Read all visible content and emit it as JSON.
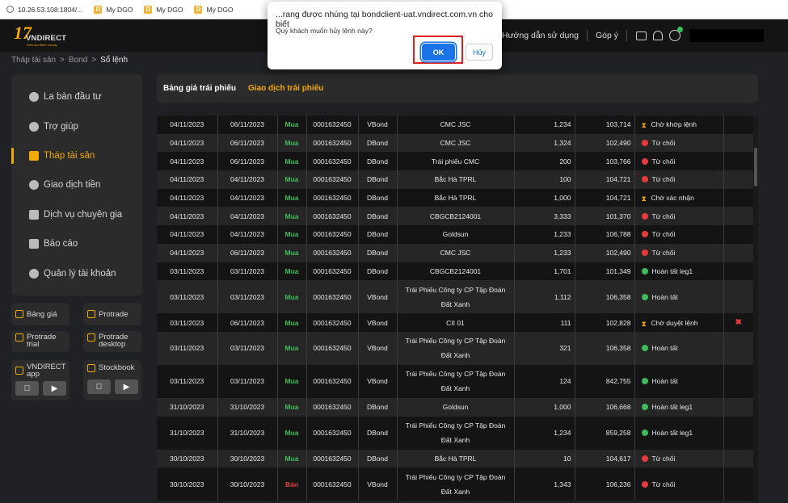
{
  "browser": {
    "bookmarks": [
      {
        "label": "10.26.53.108:1804/...",
        "icon": "globe-icon"
      },
      {
        "label": "My DGO",
        "icon": "dgo-icon"
      },
      {
        "label": "My DGO",
        "icon": "dgo-icon"
      },
      {
        "label": "My DGO",
        "icon": "dgo-icon"
      }
    ]
  },
  "dialog": {
    "title": "...rang được nhúng tại bondclient-uat.vndirect.com.vn cho biết",
    "message": "Quý khách muốn hủy lệnh này?",
    "ok_label": "OK",
    "cancel_label": "Hủy"
  },
  "header": {
    "logo_number": "17",
    "logo_brand": "VNDIRECT",
    "logo_tagline": "Kiến tạo thịnh vượng",
    "guide_label": "Hướng dẫn sử dụng",
    "feedback_label": "Góp ý"
  },
  "breadcrumb": [
    "Tháp tài sản",
    ">",
    "Bond",
    ">",
    "Sổ lệnh"
  ],
  "sidebar": {
    "items": [
      {
        "label": "La bàn đầu tư",
        "icon": "compass-icon",
        "active": false
      },
      {
        "label": "Trợ giúp",
        "icon": "help-icon",
        "active": false
      },
      {
        "label": "Tháp tài sản",
        "icon": "tower-icon",
        "active": true
      },
      {
        "label": "Giao dịch tiền",
        "icon": "money-icon",
        "active": false
      },
      {
        "label": "Dịch vụ chuyên gia",
        "icon": "expert-icon",
        "active": false
      },
      {
        "label": "Báo cáo",
        "icon": "report-icon",
        "active": false
      },
      {
        "label": "Quản lý tài khoản",
        "icon": "account-icon",
        "active": false
      }
    ]
  },
  "quick_links": {
    "banggia": "Bảng giá",
    "protrade": "Protrade",
    "protrade_trial_1": "Protrade",
    "protrade_trial_2": "trial",
    "protrade_desktop_1": "Protrade",
    "protrade_desktop_2": "desktop",
    "vnd_app_1": "VNDIRECT",
    "vnd_app_2": "app",
    "stockbook": "Stockbook"
  },
  "tabs": [
    "Bảng giá trái phiếu",
    "Giao dịch trái phiếu"
  ],
  "orders": [
    {
      "date": "04/11/2023",
      "settle": "06/11/2023",
      "side": "Mua",
      "account": "0001632450",
      "type": "VBond",
      "name": "CMC JSC",
      "qty": "1,234",
      "price": "103,714",
      "status": "Chờ khớp lệnh",
      "status_kind": "wait",
      "tall": false,
      "cancel": false
    },
    {
      "date": "04/11/2023",
      "settle": "06/11/2023",
      "side": "Mua",
      "account": "0001632450",
      "type": "DBond",
      "name": "CMC JSC",
      "qty": "1,324",
      "price": "102,490",
      "status": "Từ chối",
      "status_kind": "reject",
      "tall": false,
      "cancel": false
    },
    {
      "date": "04/11/2023",
      "settle": "06/11/2023",
      "side": "Mua",
      "account": "0001632450",
      "type": "DBond",
      "name": "Trái phiếu CMC",
      "qty": "200",
      "price": "103,766",
      "status": "Từ chối",
      "status_kind": "reject",
      "tall": false,
      "cancel": false
    },
    {
      "date": "04/11/2023",
      "settle": "04/11/2023",
      "side": "Mua",
      "account": "0001632450",
      "type": "DBond",
      "name": "Bắc Hà TPRL",
      "qty": "100",
      "price": "104,721",
      "status": "Từ chối",
      "status_kind": "reject",
      "tall": false,
      "cancel": false
    },
    {
      "date": "04/11/2023",
      "settle": "04/11/2023",
      "side": "Mua",
      "account": "0001632450",
      "type": "DBond",
      "name": "Bắc Hà TPRL",
      "qty": "1,000",
      "price": "104,721",
      "status": "Chờ xác nhận",
      "status_kind": "wait",
      "tall": false,
      "cancel": false
    },
    {
      "date": "04/11/2023",
      "settle": "04/11/2023",
      "side": "Mua",
      "account": "0001632450",
      "type": "DBond",
      "name": "CBGCB2124001",
      "qty": "3,333",
      "price": "101,370",
      "status": "Từ chối",
      "status_kind": "reject",
      "tall": false,
      "cancel": false
    },
    {
      "date": "04/11/2023",
      "settle": "04/11/2023",
      "side": "Mua",
      "account": "0001632450",
      "type": "DBond",
      "name": "Goldsun",
      "qty": "1,233",
      "price": "106,788",
      "status": "Từ chối",
      "status_kind": "reject",
      "tall": false,
      "cancel": false
    },
    {
      "date": "04/11/2023",
      "settle": "06/11/2023",
      "side": "Mua",
      "account": "0001632450",
      "type": "DBond",
      "name": "CMC JSC",
      "qty": "1,233",
      "price": "102,490",
      "status": "Từ chối",
      "status_kind": "reject",
      "tall": false,
      "cancel": false
    },
    {
      "date": "03/11/2023",
      "settle": "03/11/2023",
      "side": "Mua",
      "account": "0001632450",
      "type": "DBond",
      "name": "CBGCB2124001",
      "qty": "1,701",
      "price": "101,349",
      "status": "Hoàn tất leg1",
      "status_kind": "done",
      "tall": false,
      "cancel": false
    },
    {
      "date": "03/11/2023",
      "settle": "03/11/2023",
      "side": "Mua",
      "account": "0001632450",
      "type": "VBond",
      "name": "Trái Phiếu Công ty CP Tập Đoàn Đất Xanh",
      "qty": "1,112",
      "price": "106,358",
      "status": "Hoàn tất",
      "status_kind": "done",
      "tall": true,
      "cancel": false
    },
    {
      "date": "03/11/2023",
      "settle": "06/11/2023",
      "side": "Mua",
      "account": "0001632450",
      "type": "VBond",
      "name": "CII 01",
      "qty": "111",
      "price": "102,828",
      "status": "Chờ duyệt lệnh",
      "status_kind": "wait",
      "tall": false,
      "cancel": true
    },
    {
      "date": "03/11/2023",
      "settle": "03/11/2023",
      "side": "Mua",
      "account": "0001632450",
      "type": "VBond",
      "name": "Trái Phiếu Công ty CP Tập Đoàn Đất Xanh",
      "qty": "321",
      "price": "106,358",
      "status": "Hoàn tất",
      "status_kind": "done",
      "tall": true,
      "cancel": false
    },
    {
      "date": "03/11/2023",
      "settle": "03/11/2023",
      "side": "Mua",
      "account": "0001632450",
      "type": "VBond",
      "name": "Trái Phiếu Công ty CP Tập Đoàn Đất Xanh",
      "qty": "124",
      "price": "842,755",
      "status": "Hoàn tất",
      "status_kind": "done",
      "tall": true,
      "cancel": false
    },
    {
      "date": "31/10/2023",
      "settle": "31/10/2023",
      "side": "Mua",
      "account": "0001632450",
      "type": "DBond",
      "name": "Goldsun",
      "qty": "1,000",
      "price": "106,668",
      "status": "Hoàn tất leg1",
      "status_kind": "done",
      "tall": false,
      "cancel": false
    },
    {
      "date": "31/10/2023",
      "settle": "31/10/2023",
      "side": "Mua",
      "account": "0001632450",
      "type": "DBond",
      "name": "Trái Phiếu Công ty CP Tập Đoàn Đất Xanh",
      "qty": "1,234",
      "price": "859,258",
      "status": "Hoàn tất leg1",
      "status_kind": "done",
      "tall": true,
      "cancel": false
    },
    {
      "date": "30/10/2023",
      "settle": "30/10/2023",
      "side": "Mua",
      "account": "0001632450",
      "type": "DBond",
      "name": "Bắc Hà TPRL",
      "qty": "10",
      "price": "104,617",
      "status": "Từ chối",
      "status_kind": "reject",
      "tall": false,
      "cancel": false
    },
    {
      "date": "30/10/2023",
      "settle": "30/10/2023",
      "side": "Bán",
      "account": "0001632450",
      "type": "VBond",
      "name": "Trái Phiếu Công ty CP Tập Đoàn Đất Xanh",
      "qty": "1,343",
      "price": "106,236",
      "status": "Từ chối",
      "status_kind": "reject",
      "tall": true,
      "cancel": false
    }
  ],
  "colors": {
    "accent": "#f2a900",
    "buy": "#3dbe5b",
    "sell": "#e53b3b",
    "dialog_ok": "#1a73e8",
    "highlight_box": "#e02020"
  }
}
